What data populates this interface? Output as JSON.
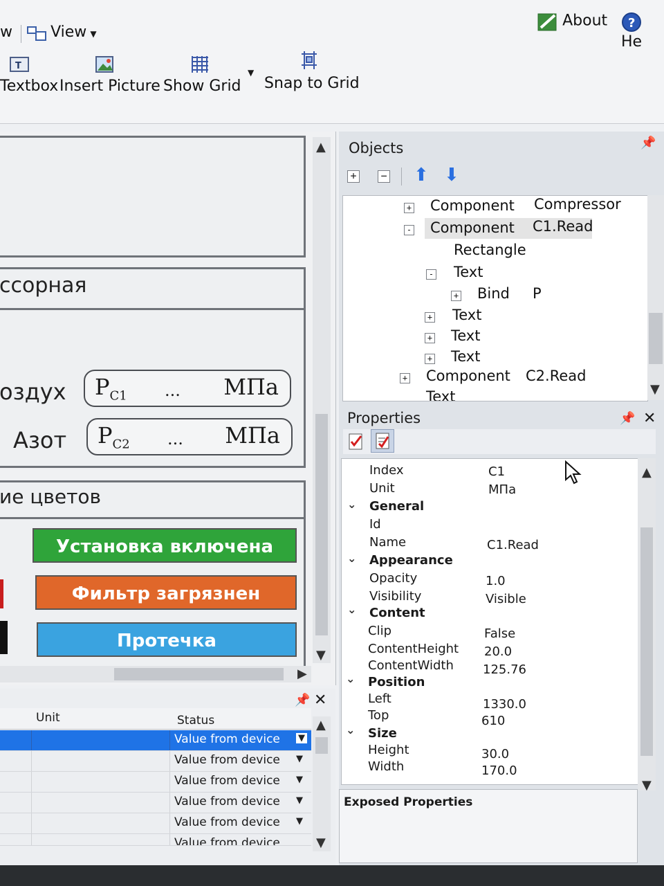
{
  "menubar": {
    "cut_item": "w",
    "view_label": "View",
    "about_label": "About",
    "help_label": "He"
  },
  "ribbon": {
    "textbox": "Textbox",
    "insert_picture": "Insert Picture",
    "show_grid": "Show Grid",
    "snap_to_grid": "Snap to Grid"
  },
  "canvas": {
    "compressor_title": "ссорная",
    "air_label": "оздух",
    "nitrogen_label": "Азот",
    "read1": {
      "symbol": "P",
      "sub": "C1",
      "value": "...",
      "unit": "МПа"
    },
    "read2": {
      "symbol": "P",
      "sub": "C2",
      "value": "...",
      "unit": "МПа"
    },
    "colors_title": "ие цветов",
    "btn_green": "Установка включена",
    "btn_orange": "Фильтр загрязнен",
    "btn_blue": "Протечка",
    "accent": {
      "green": "#2fa43a",
      "orange": "#e0672a",
      "blue": "#3aa3e0"
    }
  },
  "objects": {
    "title": "Objects",
    "tree": [
      {
        "label": "Component",
        "value": "Compressor",
        "exp": "+"
      },
      {
        "label": "Component",
        "value": "C1.Read",
        "exp": "-"
      },
      {
        "label": "Rectangle",
        "value": "",
        "exp": ""
      },
      {
        "label": "Text",
        "value": "",
        "exp": "-"
      },
      {
        "label": "Bind",
        "value": "P",
        "exp": "+"
      },
      {
        "label": "Text",
        "value": "",
        "exp": "+"
      },
      {
        "label": "Text",
        "value": "",
        "exp": "+"
      },
      {
        "label": "Text",
        "value": "",
        "exp": "+"
      },
      {
        "label": "Component",
        "value": "C2.Read",
        "exp": "+"
      },
      {
        "label": "Text",
        "value": "",
        "exp": ""
      }
    ]
  },
  "properties": {
    "title": "Properties",
    "rows": {
      "index": {
        "label": "Index",
        "value": "C1"
      },
      "unit": {
        "label": "Unit",
        "value": "МПа"
      },
      "general": "General",
      "id": {
        "label": "Id",
        "value": ""
      },
      "name": {
        "label": "Name",
        "value": "C1.Read"
      },
      "appearance": "Appearance",
      "opacity": {
        "label": "Opacity",
        "value": "1.0"
      },
      "visibility": {
        "label": "Visibility",
        "value": "Visible"
      },
      "content": "Content",
      "clip": {
        "label": "Clip",
        "value": "False"
      },
      "content_height": {
        "label": "ContentHeight",
        "value": "20.0"
      },
      "content_width": {
        "label": "ContentWidth",
        "value": "125.76"
      },
      "position": "Position",
      "left": {
        "label": "Left",
        "value": "1330.0"
      },
      "top": {
        "label": "Top",
        "value": "610"
      },
      "size": "Size",
      "height": {
        "label": "Height",
        "value": "30.0"
      },
      "width": {
        "label": "Width",
        "value": "170.0"
      }
    },
    "exposed_title": "Exposed Properties"
  },
  "bottom_grid": {
    "col_unit": "Unit",
    "col_status": "Status",
    "rows": [
      "Value from device",
      "Value from device",
      "Value from device",
      "Value from device",
      "Value from device",
      "Value from device"
    ]
  }
}
